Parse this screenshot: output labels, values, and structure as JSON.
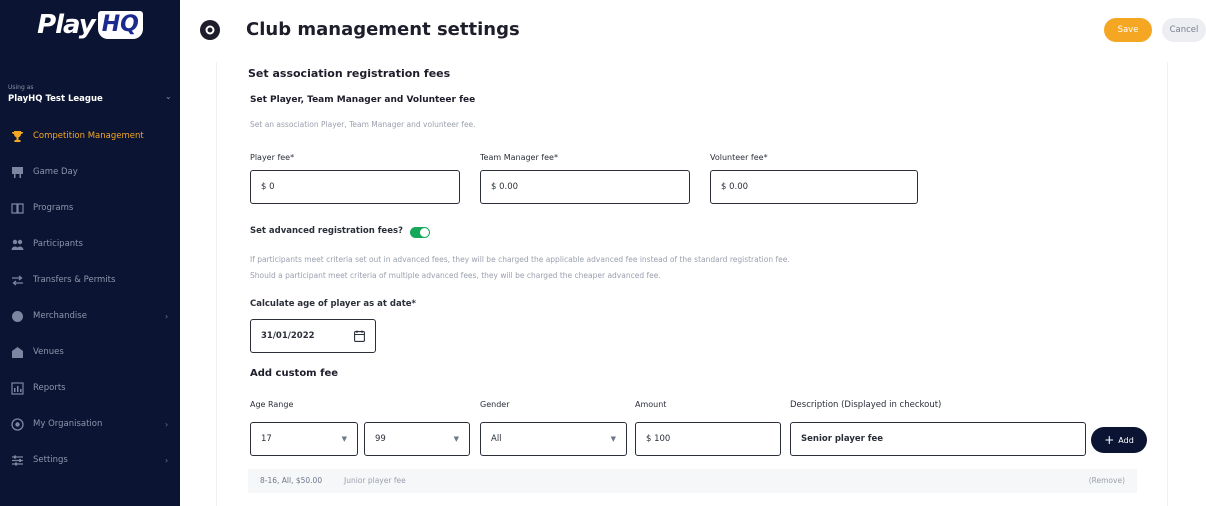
{
  "app": {
    "logo_play": "Play",
    "logo_hq": "HQ"
  },
  "sidebar": {
    "using_as": "Using as",
    "org_name": "PlayHQ Test League",
    "items": [
      {
        "label": "Competition Management",
        "icon": "trophy-icon",
        "active": true,
        "has_chevron": false
      },
      {
        "label": "Game Day",
        "icon": "scoreboard-icon",
        "active": false,
        "has_chevron": false
      },
      {
        "label": "Programs",
        "icon": "book-icon",
        "active": false,
        "has_chevron": false
      },
      {
        "label": "Participants",
        "icon": "people-icon",
        "active": false,
        "has_chevron": false
      },
      {
        "label": "Transfers & Permits",
        "icon": "transfer-icon",
        "active": false,
        "has_chevron": false
      },
      {
        "label": "Merchandise",
        "icon": "merchandise-icon",
        "active": false,
        "has_chevron": true
      },
      {
        "label": "Venues",
        "icon": "venue-icon",
        "active": false,
        "has_chevron": false
      },
      {
        "label": "Reports",
        "icon": "reports-icon",
        "active": false,
        "has_chevron": false
      },
      {
        "label": "My Organisation",
        "icon": "organisation-icon",
        "active": false,
        "has_chevron": true
      },
      {
        "label": "Settings",
        "icon": "settings-icon",
        "active": false,
        "has_chevron": true
      }
    ]
  },
  "header": {
    "title": "Club management settings",
    "save_label": "Save",
    "cancel_label": "Cancel"
  },
  "main": {
    "section_title": "Set association registration fees",
    "sub_title": "Set Player, Team Manager and Volunteer fee",
    "sub_desc": "Set an association Player, Team Manager and volunteer fee.",
    "player_fee": {
      "label": "Player fee*",
      "value": "$ 0"
    },
    "team_manager_fee": {
      "label": "Team Manager fee*",
      "value": "$ 0.00"
    },
    "volunteer_fee": {
      "label": "Volunteer fee*",
      "value": "$ 0.00"
    },
    "advanced_label": "Set advanced registration fees?",
    "advanced_enabled": true,
    "advanced_desc_1": "If participants meet criteria set out in advanced fees, they will be charged the applicable advanced fee instead of the standard registration fee.",
    "advanced_desc_2": "Should a participant meet criteria of multiple advanced fees, they will be charged the cheaper advanced fee.",
    "age_date_label": "Calculate age of player as at date*",
    "age_date_value": "31/01/2022",
    "custom_fee_title": "Add custom fee",
    "custom_fee": {
      "age_range_label": "Age Range",
      "age_from": "17",
      "age_to": "99",
      "gender_label": "Gender",
      "gender_value": "All",
      "amount_label": "Amount",
      "amount_value": "$ 100",
      "description_label": "Description (Displayed in checkout)",
      "description_value": "Senior player fee",
      "add_label": "Add"
    },
    "existing_fees": [
      {
        "summary": "8-16, All, $50.00",
        "description": "Junior player fee",
        "remove_label": "(Remove)"
      }
    ]
  },
  "colors": {
    "sidebar_bg": "#0b1533",
    "accent": "#f5a623",
    "toggle_on": "#17a85a"
  }
}
